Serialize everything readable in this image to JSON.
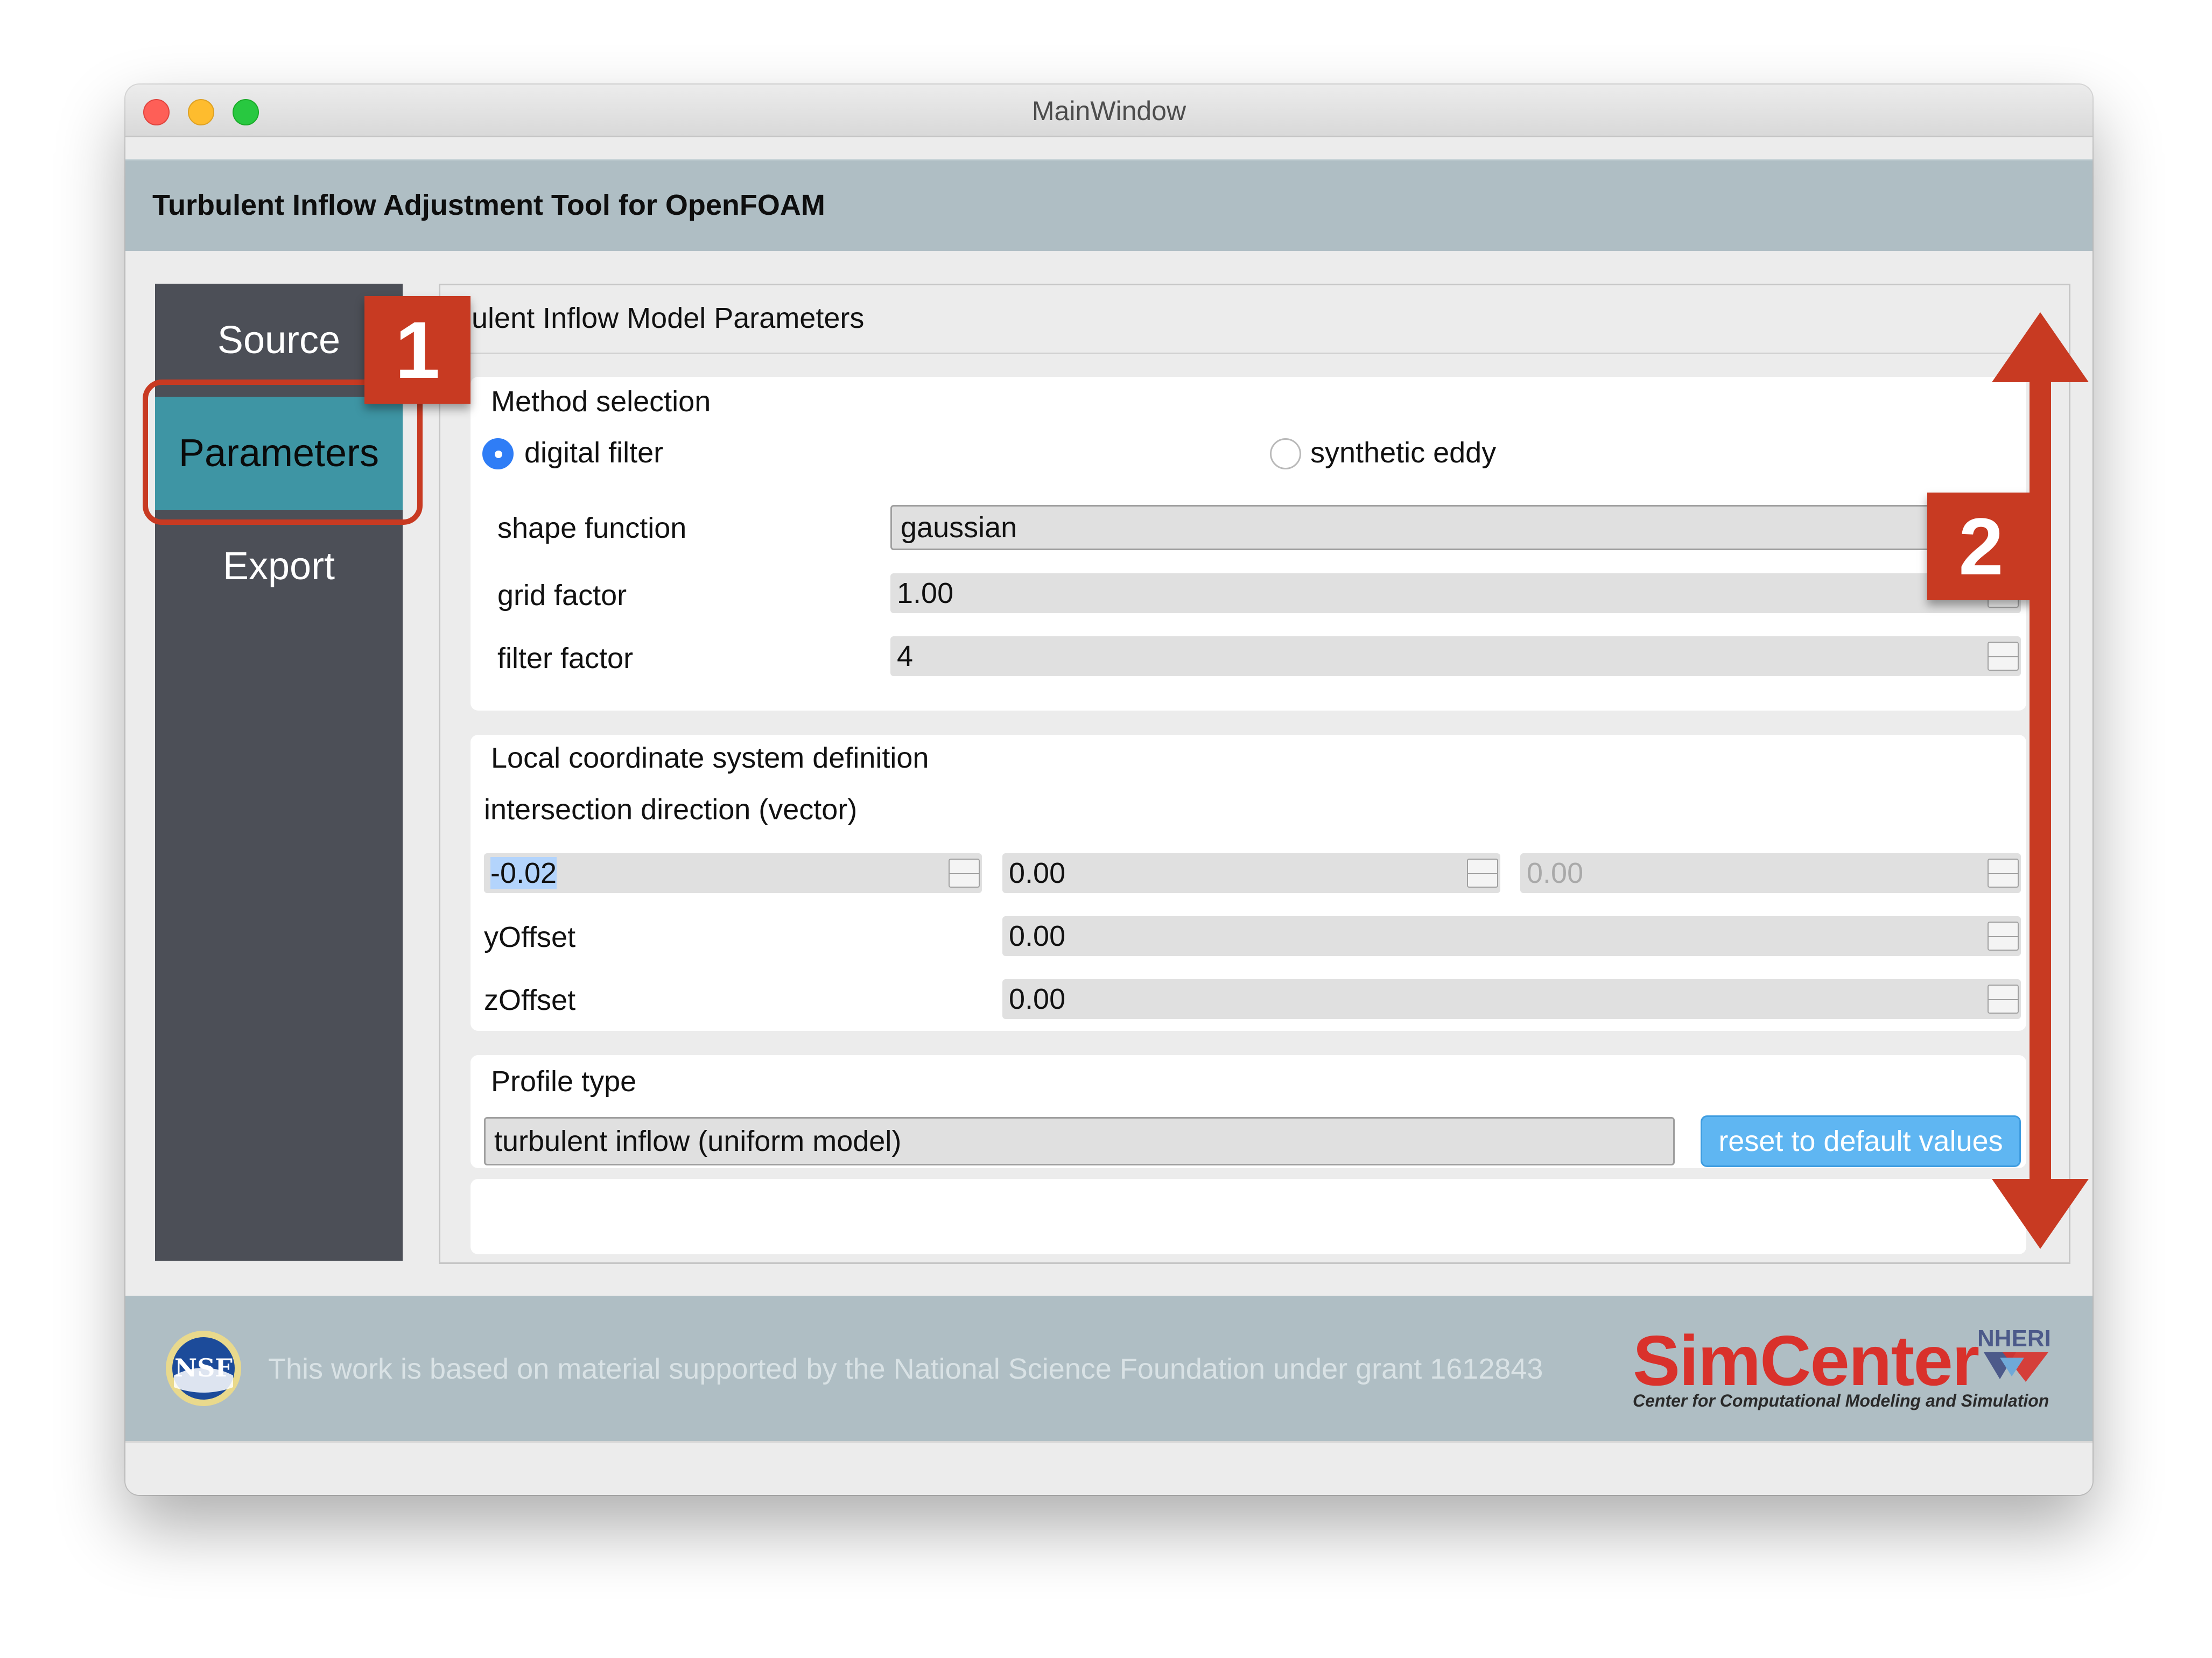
{
  "window": {
    "title": "MainWindow"
  },
  "app": {
    "title": "Turbulent Inflow Adjustment Tool for OpenFOAM"
  },
  "sidebar": {
    "items": [
      {
        "label": "Source",
        "selected": false
      },
      {
        "label": "Parameters",
        "selected": true
      },
      {
        "label": "Export",
        "selected": false
      }
    ]
  },
  "content": {
    "title": "rbulent Inflow Model Parameters",
    "method_selection": {
      "title": "Method selection",
      "options": [
        {
          "label": "digital filter",
          "checked": true
        },
        {
          "label": "synthetic eddy",
          "checked": false
        }
      ],
      "shape_function": {
        "label": "shape function",
        "value": "gaussian"
      },
      "grid_factor": {
        "label": "grid factor",
        "value": "1.00"
      },
      "filter_factor": {
        "label": "filter factor",
        "value": "4"
      }
    },
    "local_coordinates": {
      "title": "Local coordinate system definition",
      "intersection_label": "intersection direction (vector)",
      "vector": [
        "-0.02",
        "0.00",
        "0.00"
      ],
      "y_offset": {
        "label": "yOffset",
        "value": "0.00"
      },
      "z_offset": {
        "label": "zOffset",
        "value": "0.00"
      }
    },
    "profile_type": {
      "title": "Profile type",
      "value": "turbulent inflow (uniform model)",
      "reset_label": "reset to default values"
    }
  },
  "footer": {
    "text": "This work is based on material supported by the National Science Foundation under grant 1612843",
    "nsf_logo_text": "NSF",
    "simcenter_word": "SimCenter",
    "simcenter_nheri": "NHERI",
    "simcenter_sub": "Center for Computational Modeling and Simulation"
  },
  "callouts": {
    "one": "1",
    "two": "2"
  },
  "colors": {
    "accent_red": "#c83a22",
    "sidebar_bg": "#4c4f57",
    "sidebar_selected": "#3e95a4",
    "header_bg": "#afbec4",
    "button_blue": "#5fb6f2"
  }
}
